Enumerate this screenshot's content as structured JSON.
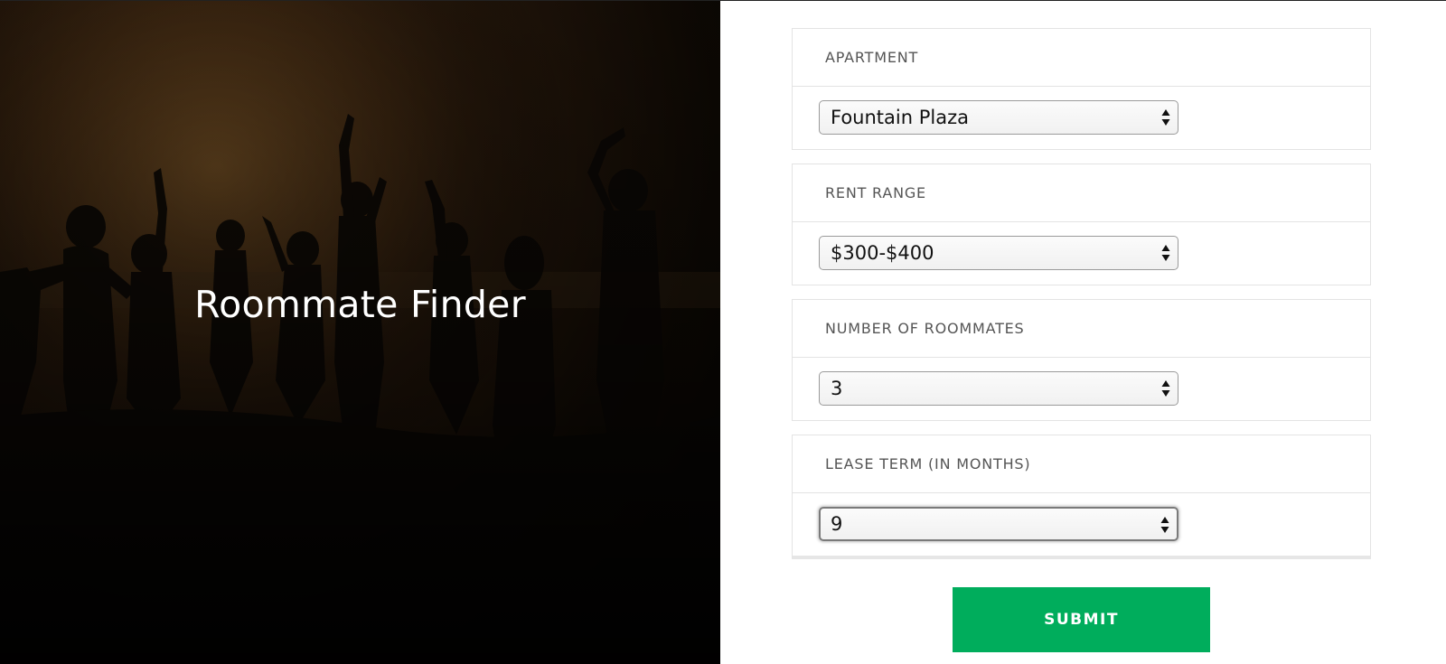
{
  "hero": {
    "title": "Roommate Finder"
  },
  "form": {
    "fields": [
      {
        "label": "APARTMENT",
        "value": "Fountain Plaza",
        "focused": false
      },
      {
        "label": "RENT RANGE",
        "value": "$300-$400",
        "focused": false
      },
      {
        "label": "NUMBER OF ROOMMATES",
        "value": "3",
        "focused": false
      },
      {
        "label": "LEASE TERM (IN MONTHS)",
        "value": "9",
        "focused": true
      }
    ],
    "submit_label": "SUBMIT"
  },
  "colors": {
    "accent": "#00ad5c",
    "label_text": "#555555",
    "card_border": "#e3e3e3"
  },
  "icons": {
    "select_arrow": "up-down-arrows-icon"
  }
}
